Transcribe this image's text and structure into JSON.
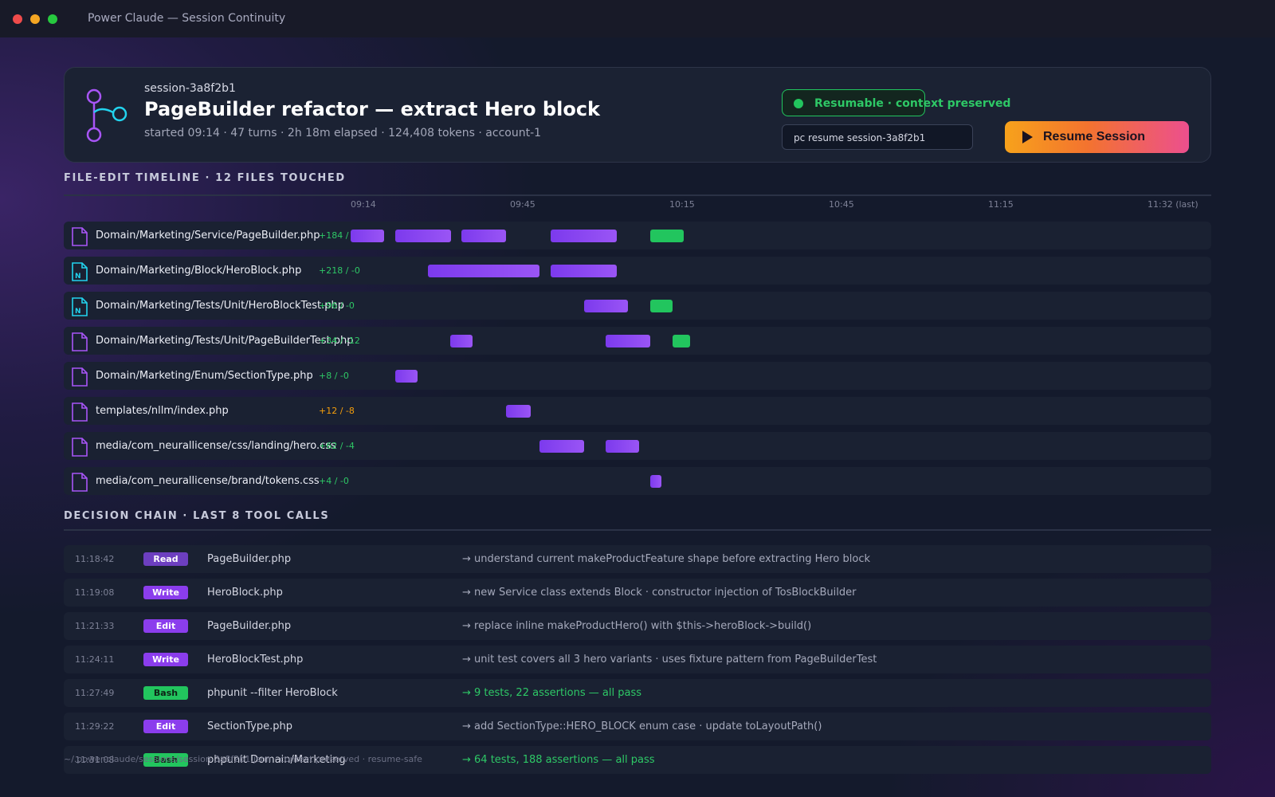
{
  "window": {
    "title": "Power Claude — Session Continuity"
  },
  "session": {
    "id": "session-3a8f2b1",
    "title": "PageBuilder refactor — extract Hero block",
    "meta": "started 09:14 · 47 turns · 2h 18m elapsed · 124,408 tokens · account-1",
    "status": "Resumable · context preserved",
    "command": "pc resume session-3a8f2b1",
    "resume_label": "Resume Session"
  },
  "colors": {
    "accent_purple": "#7c3aed",
    "accent_green": "#22c55e",
    "accent_orange": "#f7a21b",
    "accent_pink": "#ec4f8e",
    "diff_add": "#2ec866",
    "diff_mixed": "#f59e0b"
  },
  "timeline": {
    "heading": "FILE-EDIT TIMELINE · 12 FILES TOUCHED",
    "ticks": [
      "09:14",
      "09:45",
      "10:15",
      "10:45",
      "11:15",
      "11:32 (last)"
    ],
    "files": [
      {
        "path": "Domain/Marketing/Service/PageBuilder.php",
        "diff": "+184 /",
        "diff_tone": "add",
        "icon": "file-icon",
        "segments": [
          [
            0.0,
            0.042,
            "edit"
          ],
          [
            0.056,
            0.126,
            "edit"
          ],
          [
            0.139,
            0.195,
            "edit"
          ],
          [
            0.251,
            0.334,
            "edit"
          ],
          [
            0.376,
            0.418,
            "test"
          ]
        ]
      },
      {
        "path": "Domain/Marketing/Block/HeroBlock.php",
        "diff": "+218 / -0",
        "diff_tone": "add",
        "icon": "new-file-icon",
        "segments": [
          [
            0.097,
            0.237,
            "edit"
          ],
          [
            0.251,
            0.334,
            "edit"
          ]
        ]
      },
      {
        "path": "Domain/Marketing/Tests/Unit/HeroBlockTest.php",
        "diff": "+96 / -0",
        "diff_tone": "add",
        "icon": "new-file-icon",
        "segments": [
          [
            0.293,
            0.348,
            "edit"
          ],
          [
            0.376,
            0.404,
            "test"
          ]
        ]
      },
      {
        "path": "Domain/Marketing/Tests/Unit/PageBuilderTest.php",
        "diff": "+34 / -12",
        "diff_tone": "add",
        "icon": "file-icon",
        "segments": [
          [
            0.125,
            0.153,
            "edit"
          ],
          [
            0.32,
            0.376,
            "edit"
          ],
          [
            0.404,
            0.426,
            "test"
          ]
        ]
      },
      {
        "path": "Domain/Marketing/Enum/SectionType.php",
        "diff": "+8 / -0",
        "diff_tone": "add",
        "icon": "file-icon",
        "segments": [
          [
            0.056,
            0.084,
            "edit"
          ]
        ]
      },
      {
        "path": "templates/nllm/index.php",
        "diff": "+12 / -8",
        "diff_tone": "mixed",
        "icon": "file-icon",
        "segments": [
          [
            0.195,
            0.226,
            "edit"
          ]
        ]
      },
      {
        "path": "media/com_neurallicense/css/landing/hero.css",
        "diff": "+62 / -4",
        "diff_tone": "add",
        "icon": "file-icon",
        "segments": [
          [
            0.237,
            0.293,
            "edit"
          ],
          [
            0.32,
            0.362,
            "edit"
          ]
        ]
      },
      {
        "path": "media/com_neurallicense/brand/tokens.css",
        "diff": "+4 / -0",
        "diff_tone": "add",
        "icon": "file-icon",
        "segments": [
          [
            0.376,
            0.39,
            "edit"
          ]
        ]
      }
    ]
  },
  "decisions": {
    "heading": "DECISION CHAIN · LAST 8 TOOL CALLS",
    "calls": [
      {
        "time": "11:18:42",
        "tool": "Read",
        "target": "PageBuilder.php",
        "note": "→ understand current makeProductFeature shape before extracting Hero block",
        "ok": false
      },
      {
        "time": "11:19:08",
        "tool": "Write",
        "target": "HeroBlock.php",
        "note": "→ new Service class extends Block · constructor injection of TosBlockBuilder",
        "ok": false
      },
      {
        "time": "11:21:33",
        "tool": "Edit",
        "target": "PageBuilder.php",
        "note": "→ replace inline makeProductHero() with $this->heroBlock->build()",
        "ok": false
      },
      {
        "time": "11:24:11",
        "tool": "Write",
        "target": "HeroBlockTest.php",
        "note": "→ unit test covers all 3 hero variants · uses fixture pattern from PageBuilderTest",
        "ok": false
      },
      {
        "time": "11:27:49",
        "tool": "Bash",
        "target": "phpunit --filter HeroBlock",
        "note": "→ 9 tests, 22 assertions — all pass",
        "ok": true
      },
      {
        "time": "11:29:22",
        "tool": "Edit",
        "target": "SectionType.php",
        "note": "→ add SectionType::HERO_BLOCK enum case · update toLayoutPath()",
        "ok": false
      },
      {
        "time": "11:31:08",
        "tool": "Bash",
        "target": "phpunit Domain/Marketing",
        "note": "→ 64 tests, 188 assertions — all pass",
        "ok": true
      }
    ]
  },
  "footer": "~/.power-claude/sessions/session-3a8f2b1.json · context preserved · resume-safe"
}
